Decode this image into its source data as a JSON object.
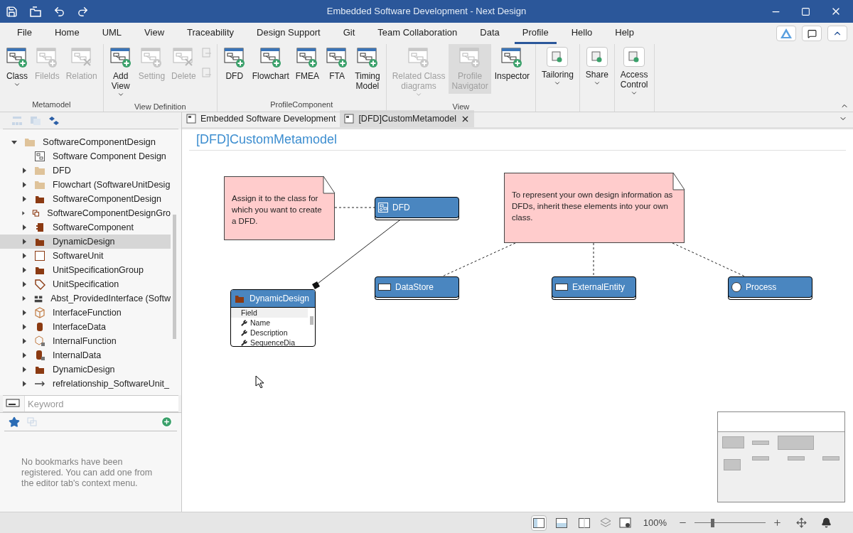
{
  "window": {
    "title": "Embedded Software Development - Next Design"
  },
  "menu_tabs": [
    {
      "label": "File",
      "selected": false
    },
    {
      "label": "Home",
      "selected": false
    },
    {
      "label": "UML",
      "selected": false
    },
    {
      "label": "View",
      "selected": false
    },
    {
      "label": "Traceability",
      "selected": false
    },
    {
      "label": "Design Support",
      "selected": false
    },
    {
      "label": "Git",
      "selected": false
    },
    {
      "label": "Team Collaboration",
      "selected": false
    },
    {
      "label": "Data",
      "selected": false
    },
    {
      "label": "Profile",
      "selected": true
    },
    {
      "label": "Hello",
      "selected": false
    },
    {
      "label": "Help",
      "selected": false
    }
  ],
  "ribbon_groups": [
    {
      "label": "Metamodel",
      "buttons": [
        {
          "kind": "large",
          "label": "Class",
          "disabled": false,
          "dropdown": true,
          "highlighted": false
        },
        {
          "kind": "large",
          "label": "Filelds",
          "disabled": true,
          "dropdown": false,
          "highlighted": false
        },
        {
          "kind": "large",
          "label": "Relation",
          "disabled": true,
          "dropdown": false,
          "highlighted": false
        }
      ]
    },
    {
      "label": "View Definition",
      "buttons": [
        {
          "kind": "large",
          "label": "Add\nView",
          "disabled": false,
          "dropdown": true,
          "highlighted": false
        },
        {
          "kind": "large",
          "label": "Setting",
          "disabled": true,
          "dropdown": false,
          "highlighted": false
        },
        {
          "kind": "large",
          "label": "Delete",
          "disabled": true,
          "dropdown": false,
          "highlighted": false
        },
        {
          "kind": "small",
          "disabled": true,
          "highlighted": false
        }
      ]
    },
    {
      "label": "ProfileComponent",
      "buttons": [
        {
          "kind": "large",
          "label": "DFD",
          "disabled": false,
          "dropdown": false,
          "highlighted": false
        },
        {
          "kind": "large",
          "label": "Flowchart",
          "disabled": false,
          "dropdown": false,
          "highlighted": false
        },
        {
          "kind": "large",
          "label": "FMEA",
          "disabled": false,
          "dropdown": false,
          "highlighted": false
        },
        {
          "kind": "large",
          "label": "FTA",
          "disabled": false,
          "dropdown": false,
          "highlighted": false
        },
        {
          "kind": "large",
          "label": "Timing\nModel",
          "disabled": false,
          "dropdown": false,
          "highlighted": false
        }
      ]
    },
    {
      "label": "View",
      "buttons": [
        {
          "kind": "large",
          "label": "Related Class\ndiagrams",
          "disabled": true,
          "dropdown": true,
          "highlighted": false
        },
        {
          "kind": "large",
          "label": "Profile\nNavigator",
          "disabled": true,
          "dropdown": false,
          "highlighted": true
        },
        {
          "kind": "large",
          "label": "Inspector",
          "disabled": false,
          "dropdown": false,
          "highlighted": false
        }
      ]
    },
    {
      "buttons": [
        {
          "kind": "framed",
          "label": "Tailoring",
          "disabled": false,
          "dropdown": true,
          "highlighted": false
        }
      ]
    },
    {
      "buttons": [
        {
          "kind": "framed",
          "label": "Share",
          "disabled": false,
          "dropdown": true,
          "highlighted": false
        }
      ]
    },
    {
      "buttons": [
        {
          "kind": "framed",
          "label": "Access\nControl",
          "disabled": false,
          "dropdown": true,
          "highlighted": false
        }
      ]
    }
  ],
  "tree": {
    "label": "SoftwareComponentDesign",
    "expanded": true,
    "selected": false,
    "children": [
      {
        "label": "Software Component Design",
        "kind": "diagram",
        "selected": false
      },
      {
        "label": "DFD",
        "kind": "light-folder",
        "expanded": false,
        "selected": false
      },
      {
        "label": "Flowchart (SoftwareUnitDesig",
        "kind": "light-folder",
        "expanded": false,
        "selected": false
      },
      {
        "label": "SoftwareComponentDesign",
        "kind": "folder",
        "expanded": false,
        "selected": false
      },
      {
        "label": "SoftwareComponentDesignGro",
        "kind": "group",
        "expanded": false,
        "selected": false
      },
      {
        "label": "SoftwareComponent",
        "kind": "component",
        "expanded": false,
        "selected": false
      },
      {
        "label": "DynamicDesign",
        "kind": "folder",
        "expanded": false,
        "selected": true
      },
      {
        "label": "SoftwareUnit",
        "kind": "frame",
        "expanded": false,
        "selected": false
      },
      {
        "label": "UnitSpecificationGroup",
        "kind": "folder",
        "expanded": false,
        "selected": false
      },
      {
        "label": "UnitSpecification",
        "kind": "tag",
        "expanded": false,
        "selected": false
      },
      {
        "label": "Abst_ProvidedInterface (Softw",
        "kind": "blocks",
        "expanded": false,
        "selected": false
      },
      {
        "label": "InterfaceFunction",
        "kind": "cube",
        "expanded": false,
        "selected": false
      },
      {
        "label": "InterfaceData",
        "kind": "cylinder",
        "expanded": false,
        "selected": false
      },
      {
        "label": "InternalFunction",
        "kind": "cube-lock",
        "expanded": false,
        "selected": false
      },
      {
        "label": "InternalData",
        "kind": "cylinder-lock",
        "expanded": false,
        "selected": false
      },
      {
        "label": "DynamicDesign",
        "kind": "folder",
        "expanded": false,
        "selected": false
      },
      {
        "label": "refrelationship_SoftwareUnit_",
        "kind": "arrow",
        "expanded": false,
        "selected": false
      }
    ]
  },
  "search": {
    "placeholder": "Keyword"
  },
  "bookmarks": {
    "message": "No bookmarks have been registered. You can add one from the editor tab's context menu."
  },
  "editor_tabs": [
    {
      "label": "Embedded Software Development",
      "selected": false,
      "closable": false
    },
    {
      "label": "[DFD]CustomMetamodel",
      "selected": true,
      "closable": true
    }
  ],
  "diagram": {
    "title": "[DFD]CustomMetamodel",
    "notes": [
      {
        "text": "Assign it to the class for which you want to create a DFD."
      },
      {
        "text": "To represent your own design information as DFDs, inherit these elements into your own class."
      }
    ],
    "classes": [
      {
        "name": "DFD",
        "kind": "dfd"
      },
      {
        "name": "DataStore",
        "kind": "store"
      },
      {
        "name": "ExternalEntity",
        "kind": "entity"
      },
      {
        "name": "Process",
        "kind": "process"
      }
    ],
    "detail_class": {
      "name": "DynamicDesign",
      "section": "Field",
      "fields": [
        "Name",
        "Description",
        "SequenceDia"
      ]
    }
  },
  "status_bar": {
    "views": [
      {
        "selected": true
      },
      {
        "selected": false
      },
      {
        "selected": false
      }
    ],
    "zoom": "100%",
    "zoom_slider": {
      "level": 0.25
    }
  }
}
